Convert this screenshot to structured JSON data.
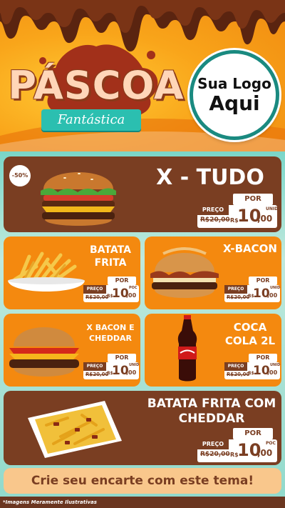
{
  "header": {
    "title": "PÁSCOA",
    "subtitle": "Fantástica",
    "logo_line1": "Sua Logo",
    "logo_line2": "Aqui"
  },
  "colors": {
    "brown": "#7a3e22",
    "orange": "#f4890f",
    "teal": "#2bbfb0",
    "cream": "#f9c78c"
  },
  "products": [
    {
      "name": "X - TUDO",
      "discount": "-50%",
      "price_label": "PREÇO",
      "per": "POR",
      "old_price": "R$20,00",
      "currency": "R$",
      "price": "10",
      "cents": ",00",
      "unit": "UNID",
      "image": "burger-icon"
    },
    {
      "name": "BATATA FRITA",
      "per": "POR",
      "price_label": "PREÇO",
      "old_price": "R$20,00",
      "currency": "R$",
      "price": "10",
      "cents": ",00",
      "unit": "POC",
      "image": "fries-icon"
    },
    {
      "name": "X-BACON",
      "per": "POR",
      "price_label": "PREÇO",
      "old_price": "R$20,00",
      "currency": "R$",
      "price": "10",
      "cents": ",00",
      "unit": "UNID",
      "image": "bacon-burger-icon"
    },
    {
      "name": "X BACON E CHEDDAR",
      "per": "POR",
      "price_label": "PREÇO",
      "old_price": "R$20,00",
      "currency": "R$",
      "price": "10",
      "cents": ",00",
      "unit": "UNID",
      "image": "cheddar-burger-icon"
    },
    {
      "name": "COCA COLA 2L",
      "per": "POR",
      "price_label": "PREÇO",
      "old_price": "R$20,00",
      "currency": "R$",
      "price": "10",
      "cents": ",00",
      "unit": "UNID",
      "image": "soda-bottle-icon"
    },
    {
      "name": "BATATA FRITA COM CHEDDAR",
      "per": "POR",
      "price_label": "PREÇO",
      "old_price": "R$20,00",
      "currency": "R$",
      "price": "10",
      "cents": ",00",
      "unit": "POC",
      "image": "cheddar-fries-icon"
    }
  ],
  "footer": {
    "cta": "Crie seu encarte com este tema!",
    "disclaimer": "*Imagens Meramente Ilustrativas"
  }
}
